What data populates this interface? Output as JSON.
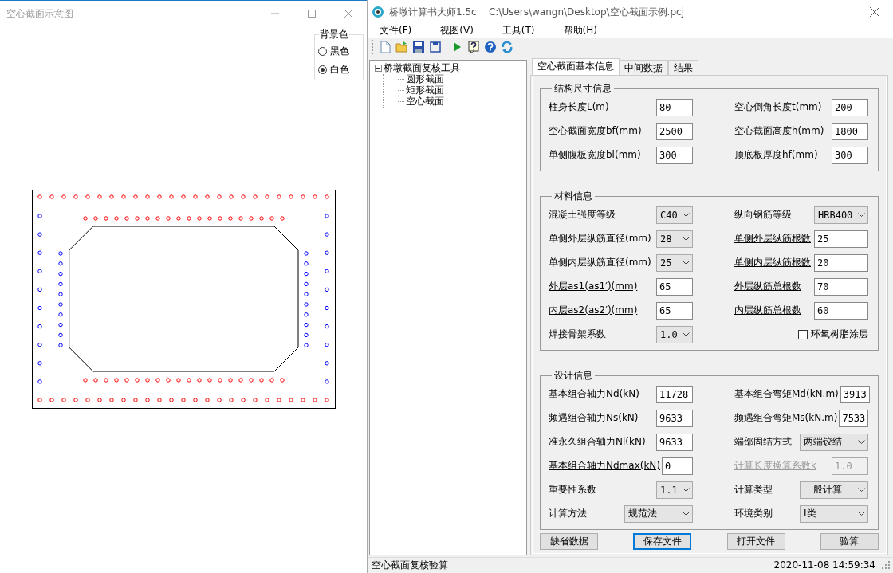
{
  "left_window": {
    "title": "空心截面示意图",
    "background_group": {
      "title": "背景色",
      "options": [
        {
          "label": "黑色",
          "selected": false
        },
        {
          "label": "白色",
          "selected": true
        }
      ]
    }
  },
  "main_window": {
    "title": "桥墩计算书大师1.5c    C:\\Users\\wangn\\Desktop\\空心截面示例.pcj",
    "menu": [
      "文件(F)",
      "视图(V)",
      "工具(T)",
      "帮助(H)"
    ],
    "tree": {
      "label": "桥墩截面复核工具",
      "expanded": true,
      "children": [
        {
          "label": "圆形截面"
        },
        {
          "label": "矩形截面"
        },
        {
          "label": "空心截面"
        }
      ]
    },
    "tabs": [
      {
        "label": "空心截面基本信息",
        "selected": true
      },
      {
        "label": "中间数据",
        "selected": false
      },
      {
        "label": "结果",
        "selected": false
      }
    ],
    "groups": [
      {
        "title": "结构尺寸信息",
        "rows": [
          [
            {
              "label": "柱身长度L(m)",
              "kind": "input",
              "value": "80",
              "underline": false,
              "disabled": false
            },
            {
              "label": "空心倒角长度t(mm)",
              "kind": "input",
              "value": "200",
              "underline": false,
              "disabled": false
            }
          ],
          [
            {
              "label": "空心截面宽度bf(mm)",
              "kind": "input",
              "value": "2500",
              "underline": false,
              "disabled": false
            },
            {
              "label": "空心截面高度h(mm)",
              "kind": "input",
              "value": "1800",
              "underline": false,
              "disabled": false
            }
          ],
          [
            {
              "label": "单侧腹板宽度bl(mm)",
              "kind": "input",
              "value": "300",
              "underline": false,
              "disabled": false
            },
            {
              "label": "顶底板厚度hf(mm)",
              "kind": "input",
              "value": "300",
              "underline": false,
              "disabled": false
            }
          ]
        ]
      },
      {
        "title": "材料信息",
        "rows": [
          [
            {
              "label": "混凝土强度等级",
              "kind": "select",
              "value": "C40",
              "underline": false,
              "disabled": false
            },
            {
              "label": "纵向钢筋等级",
              "kind": "select",
              "value": "HRB400",
              "underline": false,
              "disabled": false
            }
          ],
          [
            {
              "label": "单侧外层纵筋直径(mm)",
              "kind": "select",
              "value": "28",
              "underline": false,
              "disabled": false
            },
            {
              "label": "单侧外层纵筋根数",
              "kind": "input",
              "value": "25",
              "underline": true,
              "disabled": false
            }
          ],
          [
            {
              "label": "单侧内层纵筋直径(mm)",
              "kind": "select",
              "value": "25",
              "underline": false,
              "disabled": false
            },
            {
              "label": "单侧内层纵筋根数",
              "kind": "input",
              "value": "20",
              "underline": true,
              "disabled": false
            }
          ],
          [
            {
              "label": "外层as1(as1′)(mm)",
              "kind": "input",
              "value": "65",
              "underline": true,
              "disabled": false
            },
            {
              "label": "外层纵筋总根数",
              "kind": "input",
              "value": "70",
              "underline": true,
              "disabled": false
            }
          ],
          [
            {
              "label": "内层as2(as2′)(mm)",
              "kind": "input",
              "value": "65",
              "underline": true,
              "disabled": false
            },
            {
              "label": "内层纵筋总根数",
              "kind": "input",
              "value": "60",
              "underline": true,
              "disabled": false
            }
          ],
          [
            {
              "label": "焊接骨架系数",
              "kind": "select",
              "value": "1.0",
              "underline": false,
              "disabled": false
            },
            {
              "label": "环氧树脂涂层",
              "kind": "checkbox",
              "checked": false,
              "underline": false,
              "disabled": false
            }
          ]
        ]
      },
      {
        "title": "设计信息",
        "rows": [
          [
            {
              "label": "基本组合轴力Nd(kN)",
              "kind": "input",
              "value": "11728",
              "underline": false,
              "disabled": false
            },
            {
              "label": "基本组合弯矩Md(kN.m)",
              "kind": "input",
              "value": "3913",
              "underline": false,
              "disabled": false
            }
          ],
          [
            {
              "label": "频遇组合轴力Ns(kN)",
              "kind": "input",
              "value": "9633",
              "underline": false,
              "disabled": false
            },
            {
              "label": "频遇组合弯矩Ms(kN.m)",
              "kind": "input",
              "value": "7533",
              "underline": false,
              "disabled": false
            }
          ],
          [
            {
              "label": "准永久组合轴力Nl(kN)",
              "kind": "input",
              "value": "9633",
              "underline": false,
              "disabled": false
            },
            {
              "label": "端部固结方式",
              "kind": "select",
              "value": "两端铰结",
              "underline": false,
              "disabled": false
            }
          ],
          [
            {
              "label": "基本组合轴力Ndmax(kN)",
              "kind": "input",
              "value": "0",
              "underline": true,
              "disabled": false
            },
            {
              "label": "计算长度换算系数k",
              "kind": "input",
              "value": "1.0",
              "underline": true,
              "disabled": true
            }
          ],
          [
            {
              "label": "重要性系数",
              "kind": "select",
              "value": "1.1",
              "underline": false,
              "disabled": false
            },
            {
              "label": "计算类型",
              "kind": "select",
              "value": "一般计算",
              "underline": false,
              "disabled": false
            }
          ],
          [
            {
              "label": "计算方法",
              "kind": "select",
              "value": "规范法",
              "underline": false,
              "disabled": false
            },
            {
              "label": "环境类别",
              "kind": "select",
              "value": "Ⅰ类",
              "underline": false,
              "disabled": false
            }
          ]
        ]
      }
    ],
    "buttons": [
      {
        "label": "缺省数据",
        "focused": false
      },
      {
        "label": "保存文件",
        "focused": true
      },
      {
        "label": "打开文件",
        "focused": false
      },
      {
        "label": "验算",
        "focused": false
      }
    ],
    "status_bar": {
      "text": "空心截面复核验算",
      "time": "2020-11-08 14:59:34"
    }
  }
}
